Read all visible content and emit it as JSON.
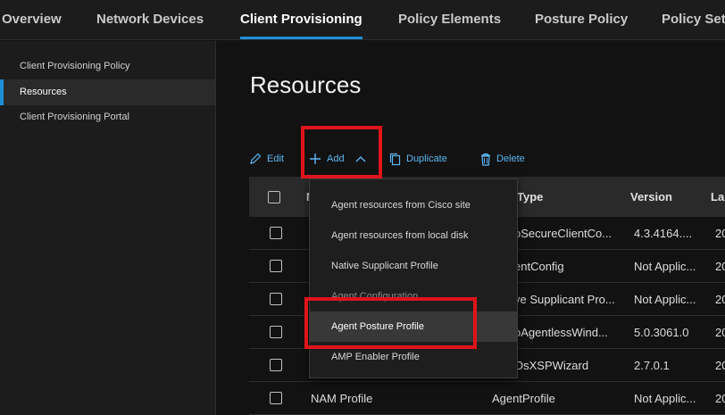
{
  "nav": {
    "tabs": [
      {
        "label": "Overview"
      },
      {
        "label": "Network Devices"
      },
      {
        "label": "Client Provisioning"
      },
      {
        "label": "Policy Elements"
      },
      {
        "label": "Posture Policy"
      },
      {
        "label": "Policy Set"
      }
    ],
    "active_index": 2
  },
  "sidebar": {
    "items": [
      {
        "label": "Client Provisioning Policy"
      },
      {
        "label": "Resources"
      },
      {
        "label": "Client Provisioning Portal"
      }
    ],
    "active_index": 1
  },
  "main": {
    "title": "Resources",
    "toolbar": {
      "edit": "Edit",
      "add": "Add",
      "duplicate": "Duplicate",
      "delete": "Delete"
    },
    "table": {
      "columns": {
        "name": "N",
        "type": "Type",
        "version": "Version",
        "last": "La"
      },
      "rows": [
        {
          "name": "",
          "type": "oSecureClientCo...",
          "version": "4.3.4164....",
          "last": "20"
        },
        {
          "name": "",
          "type": "entConfig",
          "version": "Not Applic...",
          "last": "20"
        },
        {
          "name": "",
          "type": "ve Supplicant Pro...",
          "version": "Not Applic...",
          "last": "20"
        },
        {
          "name": "",
          "type": "oAgentlessWind...",
          "version": "5.0.3061.0",
          "last": "20"
        },
        {
          "name": "",
          "type": "OsXSPWizard",
          "version": "2.7.0.1",
          "last": "20"
        },
        {
          "name": "NAM Profile",
          "type": "AgentProfile",
          "version": "Not Applic...",
          "last": "20"
        }
      ]
    },
    "add_menu": {
      "items": [
        {
          "label": "Agent resources from Cisco site"
        },
        {
          "label": "Agent resources from local disk"
        },
        {
          "label": "Native Supplicant Profile"
        },
        {
          "label": "Agent Configuration"
        },
        {
          "label": "Agent Posture Profile"
        },
        {
          "label": "AMP Enabler Profile"
        }
      ],
      "highlighted_index": 4
    }
  },
  "colors": {
    "accent": "#1d8fd9",
    "link": "#5cb6f2",
    "annotation_red": "#e0141b"
  }
}
